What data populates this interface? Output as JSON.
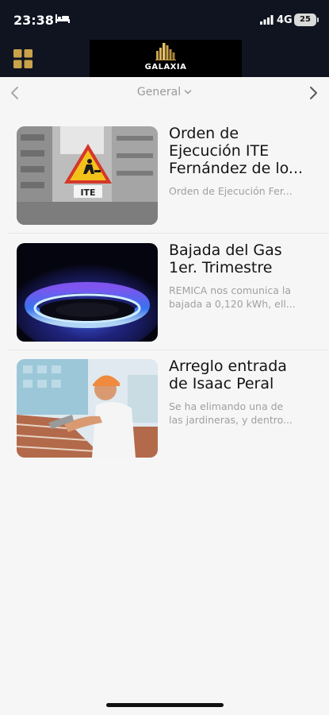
{
  "status_bar": {
    "time": "23:38",
    "network": "4G",
    "battery": "25",
    "icons": [
      "bed-icon",
      "signal-icon",
      "battery-icon"
    ]
  },
  "header": {
    "menu_icon": "grid-menu-icon",
    "logo_text": "GALAXIA",
    "logo_icon": "building-skyline-icon",
    "background": "#0f1420",
    "accent": "#c9a24a"
  },
  "category_bar": {
    "label": "General",
    "prev_icon": "chevron-left-icon",
    "next_icon": "chevron-right-icon"
  },
  "news": [
    {
      "title_lines": [
        "Orden de",
        "Ejecución ITE",
        "Fernández de lo..."
      ],
      "snippet_lines": [
        "Orden de Ejecución Fer..."
      ],
      "thumb": "construction-warning-sign-photo",
      "thumb_caption": "ITE"
    },
    {
      "title_lines": [
        "Bajada del Gas",
        "1er. Trimestre"
      ],
      "snippet_lines": [
        "REMICA nos comunica la",
        "bajada a 0,120 kWh, ell..."
      ],
      "thumb": "gas-burner-flame-photo"
    },
    {
      "title_lines": [
        "Arreglo entrada",
        "de Isaac Peral"
      ],
      "snippet_lines": [
        "Se ha elimando una de",
        "las  jardineras, y dentro..."
      ],
      "thumb": "bricklayer-worker-photo"
    }
  ]
}
